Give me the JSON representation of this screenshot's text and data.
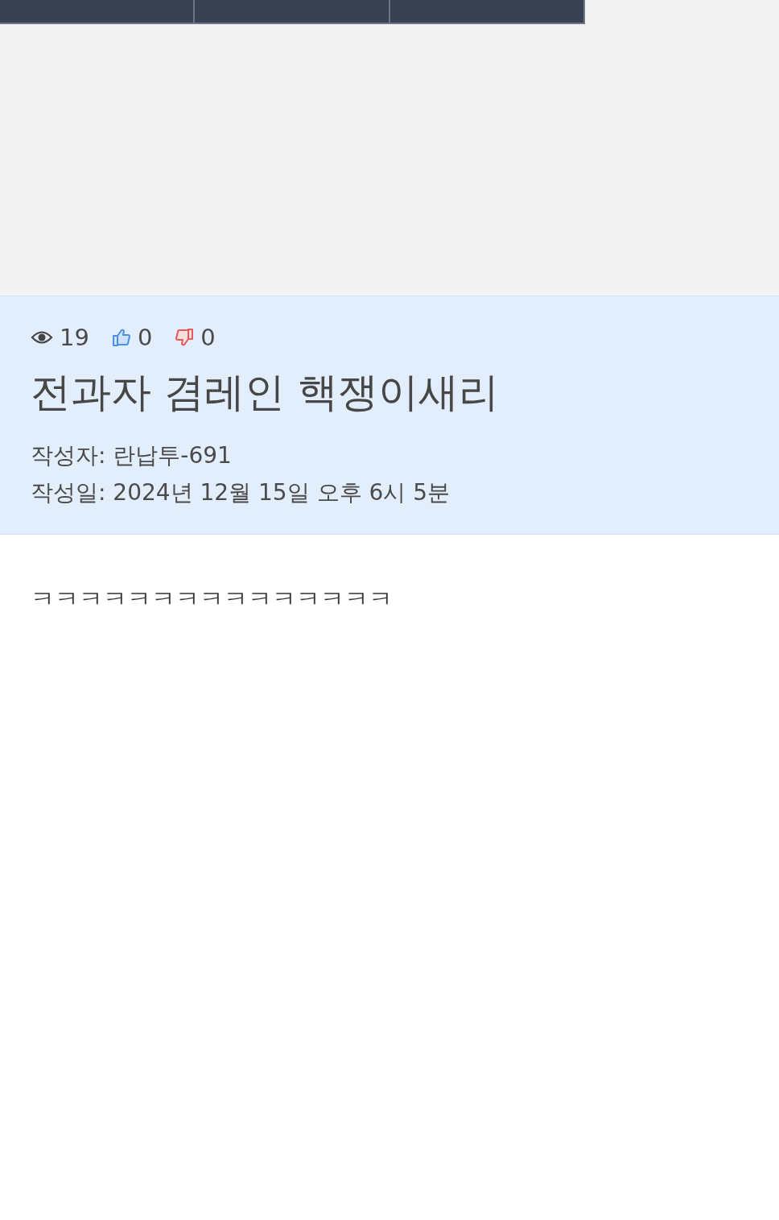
{
  "nav": {
    "tabs": [
      {
        "kind": "tab"
      },
      {
        "kind": "tab"
      },
      {
        "kind": "tab"
      }
    ]
  },
  "post": {
    "views": "19",
    "likes": "0",
    "dislikes": "0",
    "title": "전과자 겸레인 핵쟁이새리",
    "author": "작성자: 란납투-691",
    "date": "작성일: 2024년 12월 15일 오후 6시 5분",
    "body": "ㅋㅋㅋㅋㅋㅋㅋㅋㅋㅋㅋㅋㅋㅋㅋ"
  }
}
